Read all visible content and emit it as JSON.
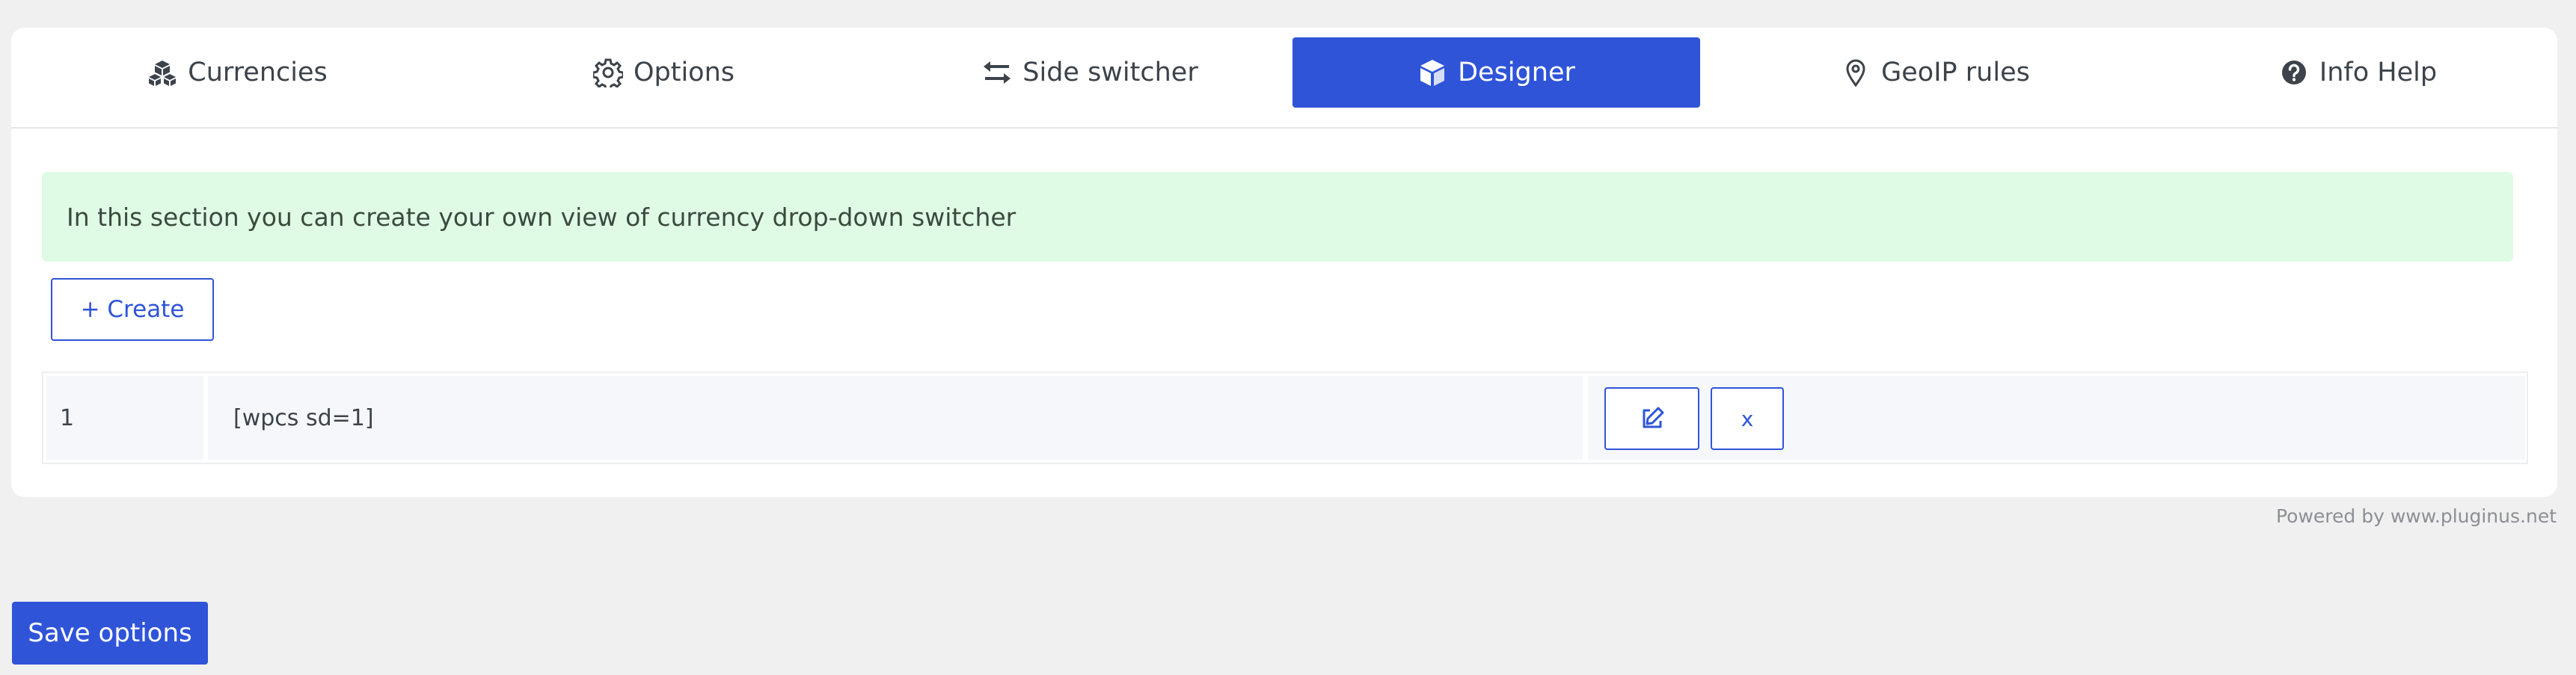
{
  "tabs": [
    {
      "label": "Currencies",
      "icon": "cubes-icon",
      "active": false
    },
    {
      "label": "Options",
      "icon": "gear-icon",
      "active": false
    },
    {
      "label": "Side switcher",
      "icon": "arrows-exchange-icon",
      "active": false
    },
    {
      "label": "Designer",
      "icon": "cube-icon",
      "active": true
    },
    {
      "label": "GeoIP rules",
      "icon": "map-pin-icon",
      "active": false
    },
    {
      "label": "Info Help",
      "icon": "question-circle-icon",
      "active": false
    }
  ],
  "notice": {
    "text": "In this section you can create your own view of currency drop-down switcher"
  },
  "create_button": {
    "label": "+ Create"
  },
  "table": {
    "rows": [
      {
        "id": "1",
        "shortcode": "[wpcs sd=1]",
        "delete_label": "x"
      }
    ]
  },
  "footer": {
    "powered": "Powered by www.pluginus.net"
  },
  "save_button": {
    "label": "Save options"
  },
  "colors": {
    "accent": "#2f54d8",
    "notice_bg": "#dffbe5",
    "page_bg": "#f0f0f1"
  }
}
